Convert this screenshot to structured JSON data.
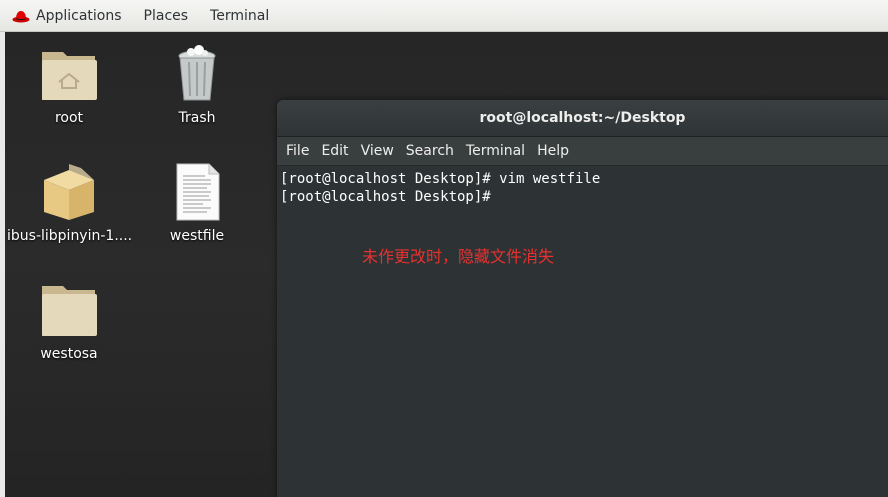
{
  "top_panel": {
    "applications": "Applications",
    "places": "Places",
    "terminal": "Terminal"
  },
  "desktop_icons": [
    {
      "label": "root",
      "icon": "home-folder-icon"
    },
    {
      "label": "Trash",
      "icon": "trash-icon"
    },
    {
      "label": "ibus-libpinyin-1....",
      "icon": "package-icon"
    },
    {
      "label": "westfile",
      "icon": "text-file-icon"
    },
    {
      "label": "westosa",
      "icon": "folder-icon"
    }
  ],
  "terminal": {
    "title": "root@localhost:~/Desktop",
    "menu": [
      "File",
      "Edit",
      "View",
      "Search",
      "Terminal",
      "Help"
    ],
    "lines": [
      "[root@localhost Desktop]# vim westfile",
      "[root@localhost Desktop]# "
    ],
    "annotation": "未作更改时，隐藏文件消失"
  },
  "colors": {
    "annotation": "#e8312f",
    "terminal_bg": "#2d3234",
    "panel_bg": "#ececea"
  }
}
